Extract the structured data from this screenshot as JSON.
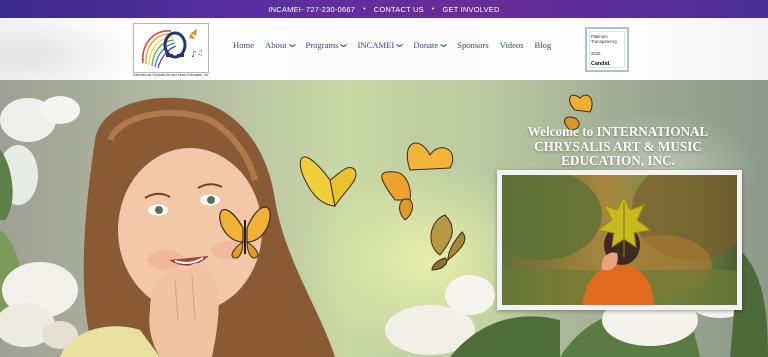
{
  "topbar": {
    "phone": "INCAMEI- 727-230-0667",
    "contact": "CONTACT US",
    "involved": "GET INVOLVED",
    "separator": "•"
  },
  "logo": {
    "caption": "International Chrysalis Art and Music Education, Inc."
  },
  "nav": {
    "items": [
      {
        "label": "Home",
        "dropdown": false
      },
      {
        "label": "About",
        "dropdown": true
      },
      {
        "label": "Programs",
        "dropdown": true
      },
      {
        "label": "INCAMEI",
        "dropdown": true
      },
      {
        "label": "Donate",
        "dropdown": true
      },
      {
        "label": "Sponsors",
        "dropdown": false
      },
      {
        "label": "Videos",
        "dropdown": false
      },
      {
        "label": "Blog",
        "dropdown": false
      }
    ]
  },
  "candid": {
    "line1": "Platinum",
    "line2": "Transparency",
    "year": "2025",
    "brand": "Candid."
  },
  "hero": {
    "title": "Welcome to INTERNATIONAL CHRYSALIS ART & MUSIC EDUCATION, INC."
  },
  "colors": {
    "topbar": "#4a2f98",
    "nav_text": "#2c4d7c",
    "hero_title": "#ffffff"
  },
  "icons": {
    "chevron": "chevron-down-icon"
  }
}
